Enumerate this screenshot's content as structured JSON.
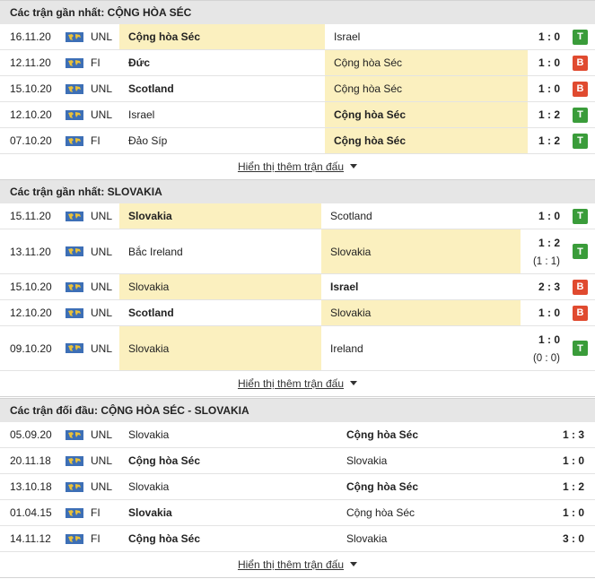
{
  "sections": [
    {
      "title": "Các trận gần nhất: CỘNG HÒA SÉC",
      "more_label": "Hiển thị thêm trận đấu",
      "rows": [
        {
          "date": "16.11.20",
          "comp": "UNL",
          "home": "Cộng hòa Séc",
          "away": "Israel",
          "score": "1 : 0",
          "result": "T",
          "home_bold": true,
          "away_bold": false,
          "hl": "home"
        },
        {
          "date": "12.11.20",
          "comp": "FI",
          "home": "Đức",
          "away": "Cộng hòa Séc",
          "score": "1 : 0",
          "result": "B",
          "home_bold": true,
          "away_bold": false,
          "hl": "away"
        },
        {
          "date": "15.10.20",
          "comp": "UNL",
          "home": "Scotland",
          "away": "Cộng hòa Séc",
          "score": "1 : 0",
          "result": "B",
          "home_bold": true,
          "away_bold": false,
          "hl": "away"
        },
        {
          "date": "12.10.20",
          "comp": "UNL",
          "home": "Israel",
          "away": "Cộng hòa Séc",
          "score": "1 : 2",
          "result": "T",
          "home_bold": false,
          "away_bold": true,
          "hl": "away"
        },
        {
          "date": "07.10.20",
          "comp": "FI",
          "home": "Đảo Síp",
          "away": "Cộng hòa Séc",
          "score": "1 : 2",
          "result": "T",
          "home_bold": false,
          "away_bold": true,
          "hl": "away"
        }
      ]
    },
    {
      "title": "Các trận gần nhất: SLOVAKIA",
      "more_label": "Hiển thị thêm trận đấu",
      "rows": [
        {
          "date": "15.11.20",
          "comp": "UNL",
          "home": "Slovakia",
          "away": "Scotland",
          "score": "1 : 0",
          "result": "T",
          "home_bold": true,
          "away_bold": false,
          "hl": "home"
        },
        {
          "date": "13.11.20",
          "comp": "UNL",
          "home": "Bắc Ireland",
          "away": "Slovakia",
          "score": "1 : 2",
          "ht": "(1 : 1)",
          "result": "T",
          "home_bold": false,
          "away_bold": false,
          "hl": "away"
        },
        {
          "date": "15.10.20",
          "comp": "UNL",
          "home": "Slovakia",
          "away": "Israel",
          "score": "2 : 3",
          "result": "B",
          "home_bold": false,
          "away_bold": true,
          "hl": "home"
        },
        {
          "date": "12.10.20",
          "comp": "UNL",
          "home": "Scotland",
          "away": "Slovakia",
          "score": "1 : 0",
          "result": "B",
          "home_bold": true,
          "away_bold": false,
          "hl": "away"
        },
        {
          "date": "09.10.20",
          "comp": "UNL",
          "home": "Slovakia",
          "away": "Ireland",
          "score": "1 : 0",
          "ht": "(0 : 0)",
          "result": "T",
          "home_bold": false,
          "away_bold": false,
          "hl": "home"
        }
      ]
    },
    {
      "title": "Các trận đối đầu: CỘNG HÒA SÉC - SLOVAKIA",
      "more_label": "Hiển thị thêm trận đấu",
      "rows": [
        {
          "date": "05.09.20",
          "comp": "UNL",
          "home": "Slovakia",
          "away": "Cộng hòa Séc",
          "score": "1 : 3",
          "home_bold": false,
          "away_bold": true
        },
        {
          "date": "20.11.18",
          "comp": "UNL",
          "home": "Cộng hòa Séc",
          "away": "Slovakia",
          "score": "1 : 0",
          "home_bold": true,
          "away_bold": false
        },
        {
          "date": "13.10.18",
          "comp": "UNL",
          "home": "Slovakia",
          "away": "Cộng hòa Séc",
          "score": "1 : 2",
          "home_bold": false,
          "away_bold": true
        },
        {
          "date": "01.04.15",
          "comp": "FI",
          "home": "Slovakia",
          "away": "Cộng hòa Séc",
          "score": "1 : 0",
          "home_bold": true,
          "away_bold": false
        },
        {
          "date": "14.11.12",
          "comp": "FI",
          "home": "Cộng hòa Séc",
          "away": "Slovakia",
          "score": "3 : 0",
          "home_bold": true,
          "away_bold": false
        }
      ]
    }
  ],
  "colors": {
    "win": "#3a9c3a",
    "loss": "#e04a2f",
    "highlight": "#fbf0bf"
  },
  "flag_icon": "world-flag-icon"
}
